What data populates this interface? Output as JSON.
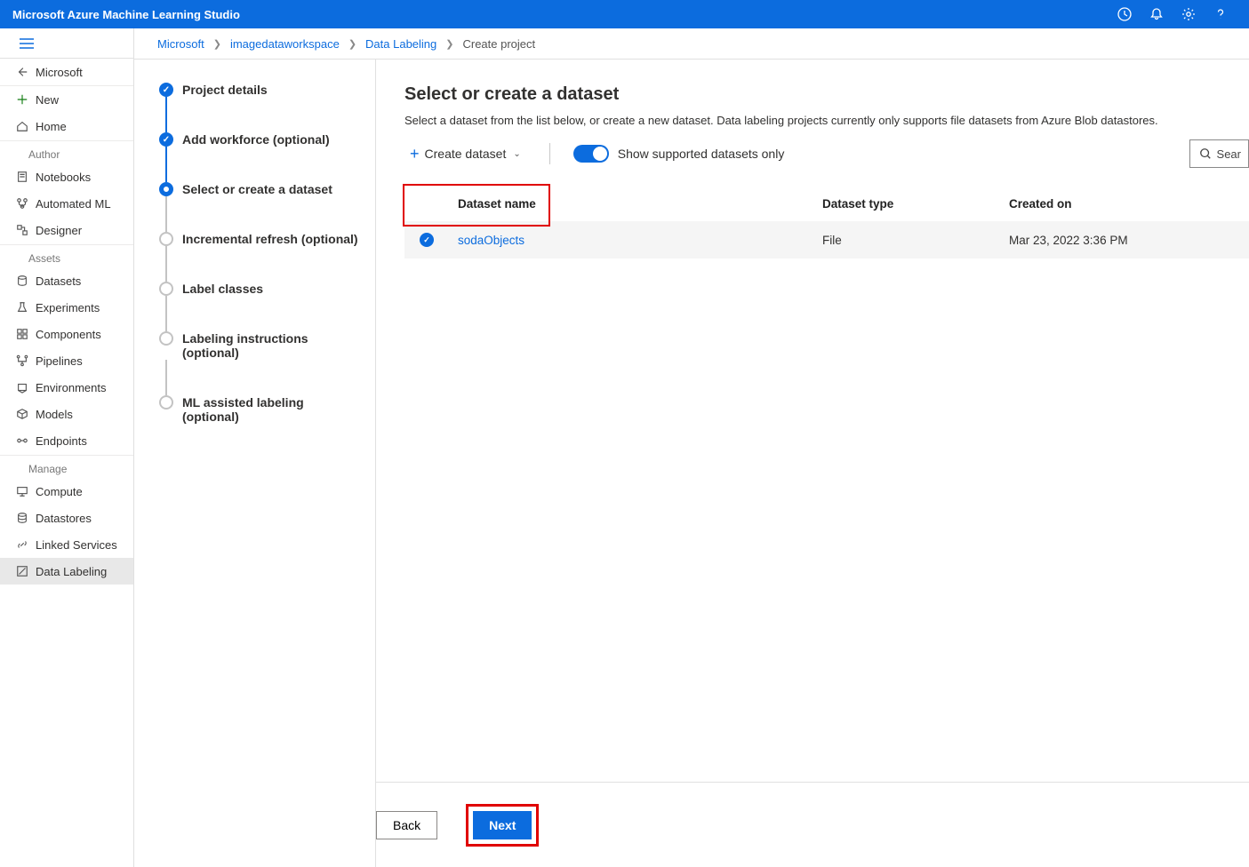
{
  "app_title": "Microsoft Azure Machine Learning Studio",
  "breadcrumbs": {
    "items": [
      "Microsoft",
      "imagedataworkspace",
      "Data Labeling"
    ],
    "current": "Create project"
  },
  "leftnav": {
    "back": "Microsoft",
    "new": "New",
    "home": "Home",
    "sections": {
      "author": "Author",
      "assets": "Assets",
      "manage": "Manage"
    },
    "author": [
      "Notebooks",
      "Automated ML",
      "Designer"
    ],
    "assets": [
      "Datasets",
      "Experiments",
      "Components",
      "Pipelines",
      "Environments",
      "Models",
      "Endpoints"
    ],
    "manage": [
      "Compute",
      "Datastores",
      "Linked Services",
      "Data Labeling"
    ]
  },
  "steps": [
    {
      "label": "Project details",
      "state": "done"
    },
    {
      "label": "Add workforce (optional)",
      "state": "done"
    },
    {
      "label": "Select or create a dataset",
      "state": "current"
    },
    {
      "label": "Incremental refresh (optional)",
      "state": "pending"
    },
    {
      "label": "Label classes",
      "state": "pending"
    },
    {
      "label": "Labeling instructions (optional)",
      "state": "pending"
    },
    {
      "label": "ML assisted labeling (optional)",
      "state": "pending"
    }
  ],
  "page": {
    "heading": "Select or create a dataset",
    "description": "Select a dataset from the list below, or create a new dataset. Data labeling projects currently only supports file datasets from Azure Blob datastores.",
    "create_dataset": "Create dataset",
    "toggle_label": "Show supported datasets only",
    "search_placeholder": "Sear"
  },
  "table": {
    "columns": {
      "name": "Dataset name",
      "type": "Dataset type",
      "created": "Created on"
    },
    "rows": [
      {
        "name": "sodaObjects",
        "type": "File",
        "created": "Mar 23, 2022 3:36 PM",
        "selected": true
      }
    ]
  },
  "footer": {
    "back": "Back",
    "next": "Next"
  }
}
